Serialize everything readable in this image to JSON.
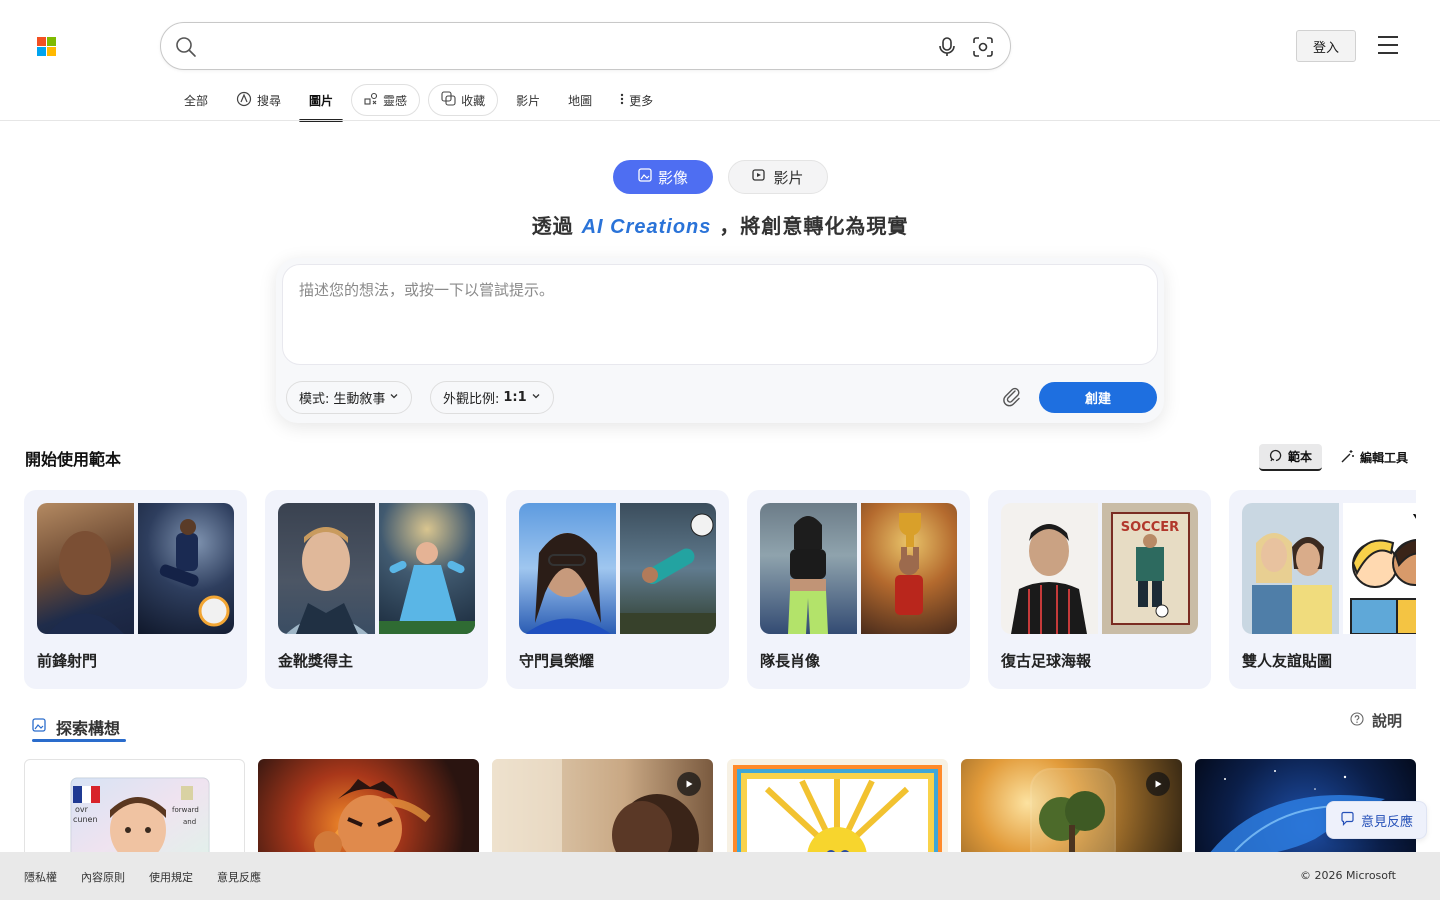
{
  "header": {
    "search_placeholder": "",
    "login_label": "登入"
  },
  "tabs": [
    {
      "label": "全部"
    },
    {
      "label": "搜尋"
    },
    {
      "label": "圖片"
    },
    {
      "label": "靈感"
    },
    {
      "label": "收藏"
    },
    {
      "label": "影片"
    },
    {
      "label": "地圖"
    },
    {
      "label": "更多"
    }
  ],
  "mode_toggle": {
    "image_label": "影像",
    "video_label": "影片"
  },
  "headline": {
    "prefix": "透過",
    "brand": "AI Creations",
    "suffix": "，將創意轉化為現實"
  },
  "prompt": {
    "placeholder": "描述您的想法，或按一下以嘗試提示。",
    "mode_label": "模式:",
    "mode_value": "生動敘事",
    "ratio_label": "外觀比例:",
    "ratio_value": "1:1",
    "create_label": "創建"
  },
  "templates": {
    "title": "開始使用範本",
    "segment_templates": "範本",
    "segment_tools": "編輯工具",
    "cards": [
      {
        "label": "前鋒射門"
      },
      {
        "label": "金靴獎得主"
      },
      {
        "label": "守門員榮耀"
      },
      {
        "label": "隊長肖像"
      },
      {
        "label": "復古足球海報"
      },
      {
        "label": "雙人友誼貼圖"
      }
    ]
  },
  "explore": {
    "title": "探索構想",
    "help_label": "說明"
  },
  "feedback_label": "意見反應",
  "footer": {
    "links": [
      "隱私權",
      "內容原則",
      "使用規定",
      "意見反應"
    ],
    "copyright": "© 2026 Microsoft"
  },
  "colors": {
    "accent": "#4e6ef2",
    "create": "#1e6fe0",
    "brand_text": "#2a73d8",
    "card_bg": "#f1f3fb"
  }
}
